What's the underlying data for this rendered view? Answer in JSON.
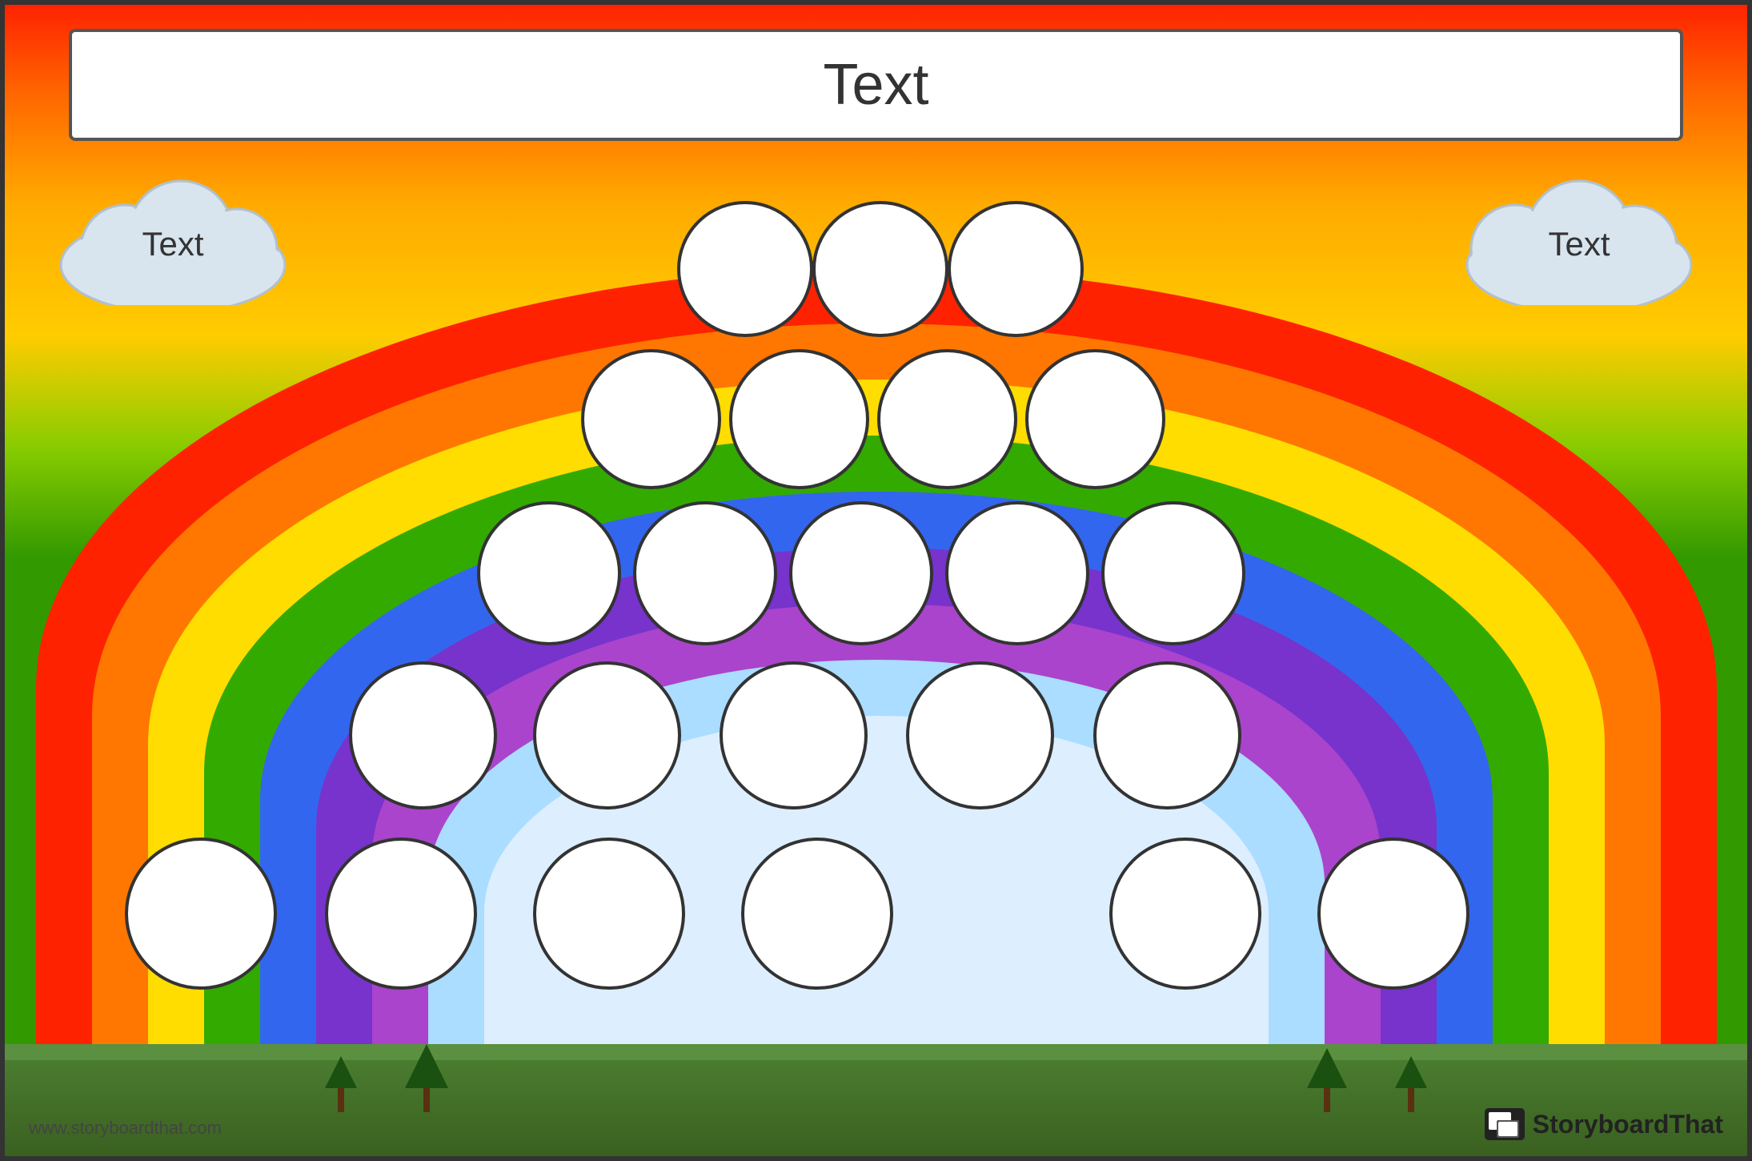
{
  "title": {
    "text": "Text",
    "placeholder": "Text"
  },
  "clouds": {
    "left": {
      "text": "Text"
    },
    "right": {
      "text": "Text"
    }
  },
  "branding": {
    "website": "www.storyboardthat.com",
    "name_part1": "Storyboard",
    "name_part2": "That"
  },
  "circles": [
    {
      "id": 1,
      "row": 1,
      "col": 1
    },
    {
      "id": 2,
      "row": 1,
      "col": 2
    },
    {
      "id": 3,
      "row": 1,
      "col": 3
    },
    {
      "id": 4,
      "row": 2,
      "col": 1
    },
    {
      "id": 5,
      "row": 2,
      "col": 2
    },
    {
      "id": 6,
      "row": 2,
      "col": 3
    },
    {
      "id": 7,
      "row": 2,
      "col": 4
    },
    {
      "id": 8,
      "row": 3,
      "col": 1
    },
    {
      "id": 9,
      "row": 3,
      "col": 2
    },
    {
      "id": 10,
      "row": 3,
      "col": 3
    },
    {
      "id": 11,
      "row": 3,
      "col": 4
    },
    {
      "id": 12,
      "row": 3,
      "col": 5
    },
    {
      "id": 13,
      "row": 4,
      "col": 1
    },
    {
      "id": 14,
      "row": 4,
      "col": 2
    },
    {
      "id": 15,
      "row": 4,
      "col": 3
    },
    {
      "id": 16,
      "row": 4,
      "col": 4
    },
    {
      "id": 17,
      "row": 4,
      "col": 5
    },
    {
      "id": 18,
      "row": 5,
      "col": 1
    },
    {
      "id": 19,
      "row": 5,
      "col": 2
    },
    {
      "id": 20,
      "row": 5,
      "col": 3
    },
    {
      "id": 21,
      "row": 5,
      "col": 4
    },
    {
      "id": 22,
      "row": 5,
      "col": 5
    },
    {
      "id": 23,
      "row": 5,
      "col": 6
    }
  ]
}
